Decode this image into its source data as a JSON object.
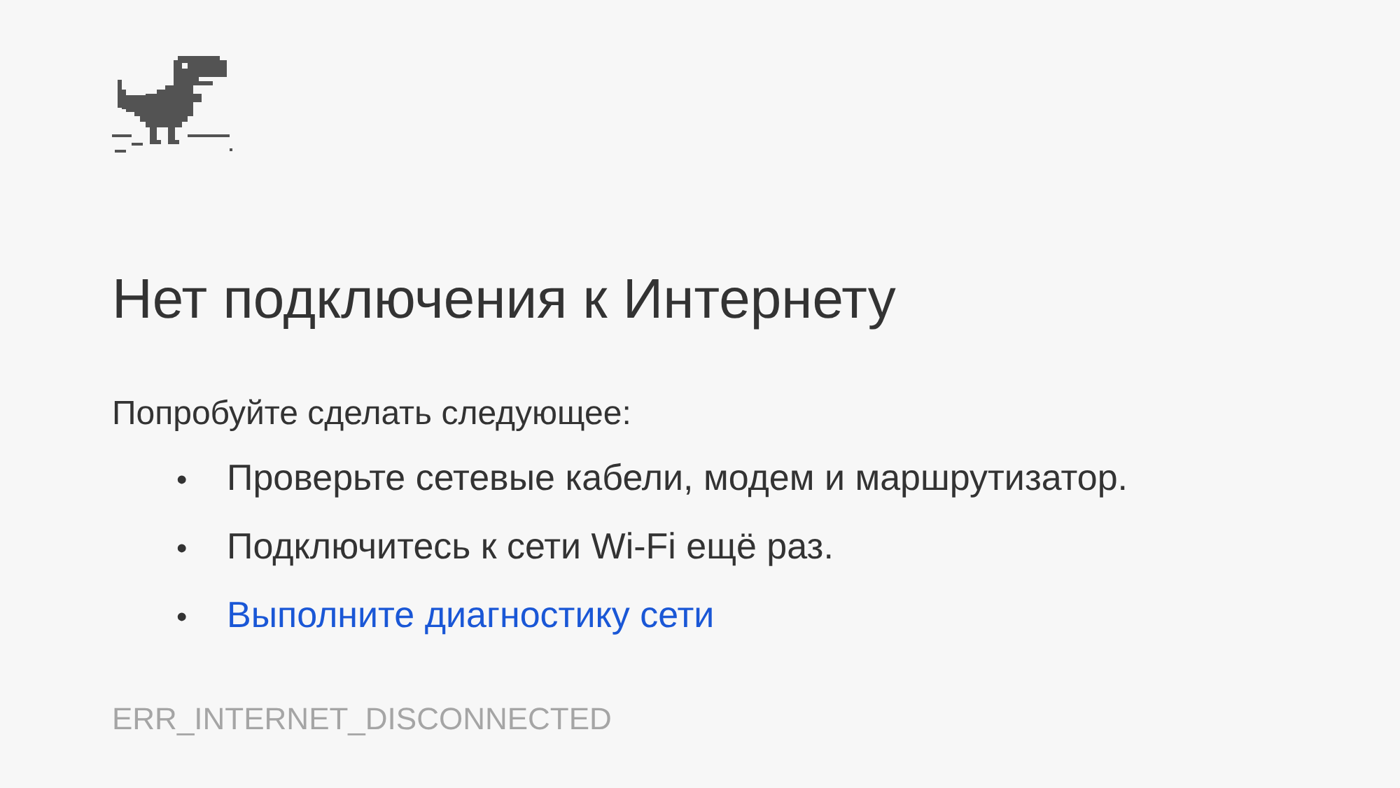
{
  "title": "Нет подключения к Интернету",
  "intro": "Попробуйте сделать следующее:",
  "suggestions": [
    {
      "kind": "text",
      "bullet": "•",
      "text": "Проверьте сетевые кабели, модем и маршрутизатор."
    },
    {
      "kind": "text",
      "bullet": "•",
      "text": "Подключитесь к сети Wi-Fi ещё раз."
    },
    {
      "kind": "link",
      "bullet": "•",
      "text": "Выполните диагностику сети"
    }
  ],
  "error_code": "ERR_INTERNET_DISCONNECTED"
}
